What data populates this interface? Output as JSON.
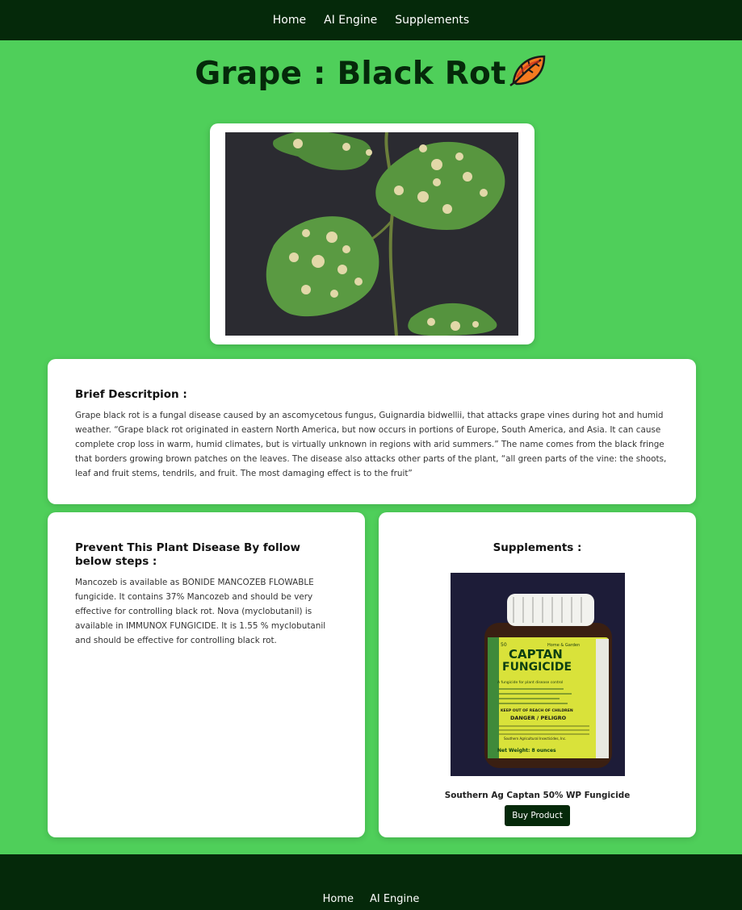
{
  "nav": {
    "items": [
      {
        "label": "Home"
      },
      {
        "label": "AI Engine"
      },
      {
        "label": "Supplements"
      }
    ]
  },
  "page": {
    "title": "Grape : Black Rot"
  },
  "hero": {
    "image_icon": "grape-leaf-photo"
  },
  "description": {
    "heading": "Brief Descritpion :",
    "text": "Grape black rot is a fungal disease caused by an ascomycetous fungus, Guignardia bidwellii, that attacks grape vines during hot and humid weather. “Grape black rot originated in eastern North America, but now occurs in portions of Europe, South America, and Asia. It can cause complete crop loss in warm, humid climates, but is virtually unknown in regions with arid summers.” The name comes from the black fringe that borders growing brown patches on the leaves. The disease also attacks other parts of the plant, “all green parts of the vine: the shoots, leaf and fruit stems, tendrils, and fruit. The most damaging effect is to the fruit”"
  },
  "prevent": {
    "heading": "Prevent This Plant Disease By follow below steps :",
    "text": "Mancozeb is available as BONIDE MANCOZEB FLOWABLE fungicide. It contains 37% Mancozeb and should be very effective for controlling black rot. Nova (myclobutanil) is available in IMMUNOX FUNGICIDE. It is 1.55 % myclobutanil and should be effective for controlling black rot."
  },
  "supplements": {
    "heading": "Supplements :",
    "product_name": "Southern Ag Captan 50% WP Fungicide",
    "buy_label": "Buy Product",
    "label_top": "50",
    "label_brand": "Home & Garden",
    "label_line1": "CAPTAN",
    "label_line2": "FUNGICIDE",
    "label_use": "A fungicide for plant disease control",
    "label_keep": "KEEP OUT OF REACH OF CHILDREN",
    "label_danger": "DANGER / PELIGRO",
    "label_maker": "Southern Agricultural Insecticides, Inc.",
    "label_weight": "Net Weight: 8 ounces"
  },
  "footer": {
    "items": [
      {
        "label": "Home"
      },
      {
        "label": "AI Engine"
      }
    ]
  },
  "colors": {
    "background": "#4fcf5a",
    "dark_green": "#05290a",
    "card": "#ffffff"
  }
}
